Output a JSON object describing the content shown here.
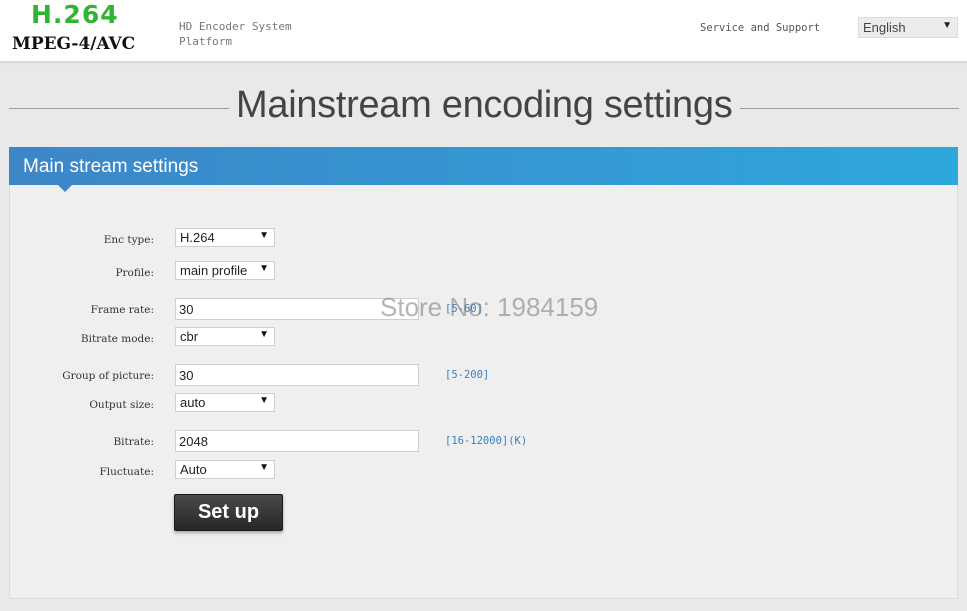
{
  "header": {
    "logo_h264": "H.264",
    "logo_mpeg": "MPEG-4/AVC",
    "platform": "HD Encoder System Platform",
    "support_link": "Service and Support",
    "language": {
      "selected": "English",
      "arrow": "▼"
    }
  },
  "page_title": "Mainstream encoding settings",
  "panel": {
    "title": "Main stream settings",
    "fields": {
      "enc_type": {
        "label": "Enc type:",
        "value": "H.264"
      },
      "profile": {
        "label": "Profile:",
        "value": "main profile"
      },
      "frame_rate": {
        "label": "Frame rate:",
        "value": "30",
        "hint": "[5-60]"
      },
      "bitrate_mode": {
        "label": "Bitrate mode:",
        "value": "cbr"
      },
      "gop": {
        "label": "Group of picture:",
        "value": "30",
        "hint": "[5-200]"
      },
      "output_size": {
        "label": "Output size:",
        "value": "auto"
      },
      "bitrate": {
        "label": "Bitrate:",
        "value": "2048",
        "hint": "[16-12000](K)"
      },
      "fluctuate": {
        "label": "Fluctuate:",
        "value": "Auto"
      }
    },
    "setup_button": "Set up"
  },
  "watermark": "Store No: 1984159",
  "colors": {
    "accent_blue": "#2ea7da",
    "logo_green": "#2fb52f",
    "hint_blue": "#3a7fbf"
  },
  "icons": {
    "dropdown": "chevron-down-icon"
  }
}
